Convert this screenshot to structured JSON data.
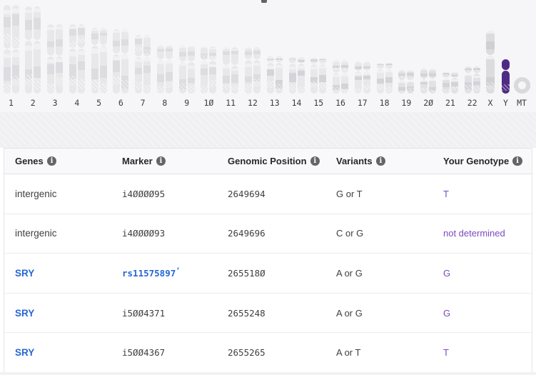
{
  "ideogram": {
    "selected_chromosome": "Y",
    "selected_color": "#4f2b86",
    "chromosome_color": "#e8e8eb",
    "chromosomes": [
      {
        "label": "1"
      },
      {
        "label": "2"
      },
      {
        "label": "3"
      },
      {
        "label": "4"
      },
      {
        "label": "5"
      },
      {
        "label": "6"
      },
      {
        "label": "7"
      },
      {
        "label": "8"
      },
      {
        "label": "9"
      },
      {
        "label": "10"
      },
      {
        "label": "11"
      },
      {
        "label": "12"
      },
      {
        "label": "13"
      },
      {
        "label": "14"
      },
      {
        "label": "15"
      },
      {
        "label": "16"
      },
      {
        "label": "17"
      },
      {
        "label": "18"
      },
      {
        "label": "19"
      },
      {
        "label": "20"
      },
      {
        "label": "21"
      },
      {
        "label": "22"
      },
      {
        "label": "X"
      },
      {
        "label": "Y"
      },
      {
        "label": "MT"
      }
    ]
  },
  "table": {
    "columns": [
      {
        "label": "Genes"
      },
      {
        "label": "Marker"
      },
      {
        "label": "Genomic Position"
      },
      {
        "label": "Variants"
      },
      {
        "label": "Your Genotype"
      }
    ],
    "colors": {
      "link_blue": "#2667d4",
      "genotype_purple": "#7b49c0"
    },
    "rows": [
      {
        "gene": "intergenic",
        "gene_link": false,
        "marker": "i4000095",
        "marker_link": false,
        "position": "2649694",
        "variants": "G or T",
        "genotype": "T"
      },
      {
        "gene": "intergenic",
        "gene_link": false,
        "marker": "i4000093",
        "marker_link": false,
        "position": "2649696",
        "variants": "C or G",
        "genotype": "not determined"
      },
      {
        "gene": "SRY",
        "gene_link": true,
        "marker": "rs11575897",
        "marker_link": true,
        "marker_sup": "’",
        "position": "2655180",
        "variants": "A or G",
        "genotype": "G"
      },
      {
        "gene": "SRY",
        "gene_link": true,
        "marker": "i5004371",
        "marker_link": false,
        "position": "2655248",
        "variants": "A or G",
        "genotype": "G"
      },
      {
        "gene": "SRY",
        "gene_link": true,
        "marker": "i5004367",
        "marker_link": false,
        "position": "2655265",
        "variants": "A or T",
        "genotype": "T"
      }
    ]
  }
}
